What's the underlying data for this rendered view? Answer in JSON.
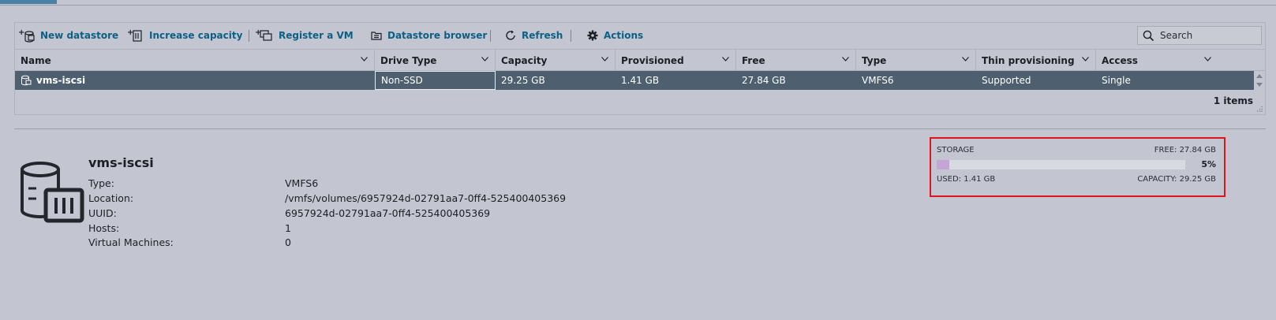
{
  "toolbar": {
    "new_datastore": "New datastore",
    "increase_capacity": "Increase capacity",
    "register_vm": "Register a VM",
    "datastore_browser": "Datastore browser",
    "refresh": "Refresh",
    "actions": "Actions",
    "search_placeholder": "Search"
  },
  "table": {
    "columns": [
      "Name",
      "Drive Type",
      "Capacity",
      "Provisioned",
      "Free",
      "Type",
      "Thin provisioning",
      "Access"
    ],
    "rows": [
      {
        "name": "vms-iscsi",
        "drive_type": "Non-SSD",
        "capacity": "29.25 GB",
        "provisioned": "1.41 GB",
        "free": "27.84 GB",
        "type": "VMFS6",
        "thin_provisioning": "Supported",
        "access": "Single"
      }
    ],
    "item_count": "1 items"
  },
  "details": {
    "name": "vms-iscsi",
    "labels": {
      "type": "Type:",
      "location": "Location:",
      "uuid": "UUID:",
      "hosts": "Hosts:",
      "vms": "Virtual Machines:"
    },
    "values": {
      "type": "VMFS6",
      "location": "/vmfs/volumes/6957924d-02791aa7-0ff4-525400405369",
      "uuid": "6957924d-02791aa7-0ff4-525400405369",
      "hosts": "1",
      "vms": "0"
    }
  },
  "storage": {
    "label": "STORAGE",
    "free": "FREE: 27.84 GB",
    "percent_label": "5%",
    "used_fraction": 0.05,
    "used": "USED: 1.41 GB",
    "capacity": "CAPACITY: 29.25 GB"
  },
  "colors": {
    "accent": "#0d5f85",
    "selected_row": "#4e5f70",
    "storage_fill": "#c3a6d6",
    "highlight_border": "#e0141e"
  }
}
